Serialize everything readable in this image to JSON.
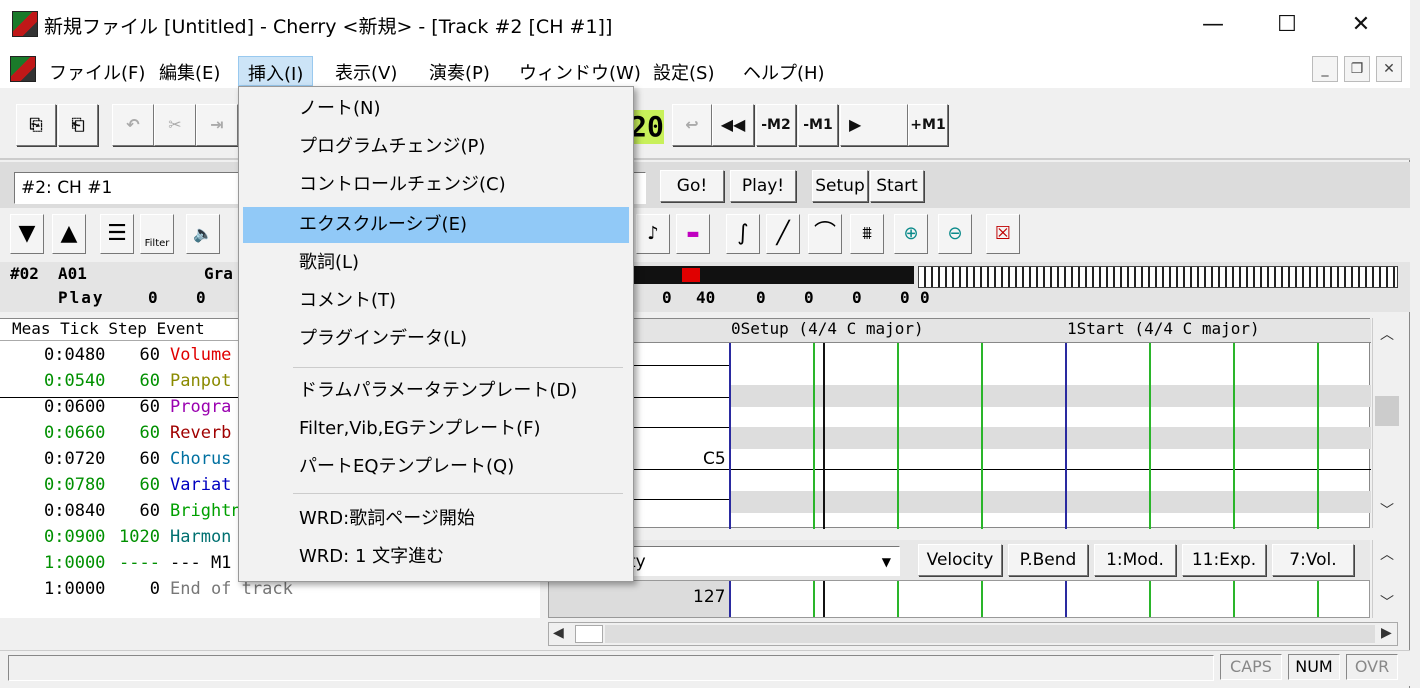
{
  "window": {
    "title": "新規ファイル [Untitled] - Cherry <新規>  - [Track #2 [CH #1]]",
    "minimize": "—",
    "maximize": "☐",
    "close": "✕"
  },
  "menubar": {
    "items": [
      "ファイル(F)",
      "編集(E)",
      "挿入(I)",
      "表示(V)",
      "演奏(P)",
      "ウィンドウ(W)",
      "設定(S)",
      "ヘルプ(H)"
    ],
    "active_index": 2
  },
  "insert_menu": {
    "items": [
      "ノート(N)",
      "プログラムチェンジ(P)",
      "コントロールチェンジ(C)",
      "エクスクルーシブ(E)",
      "歌詞(L)",
      "コメント(T)",
      "プラグインデータ(L)",
      "ドラムパラメータテンプレート(D)",
      "Filter,Vib,EGテンプレート(F)",
      "パートEQテンプレート(Q)",
      "WRD:歌詞ページ開始",
      "WRD: 1 文字進む"
    ],
    "highlighted_index": 3
  },
  "transport": {
    "counter": "20",
    "m2": "-M2",
    "m1": "-M1",
    "p1": "+M1"
  },
  "track_selector": "#2: CH #1",
  "track_buttons": {
    "go": "Go!",
    "play": "Play!",
    "setup": "Setup",
    "start": "Start"
  },
  "filter_label": "Filter",
  "status_strip": {
    "track_no": "#02",
    "port": "A01",
    "name_fragment": "Gra",
    "play_label": "Play",
    "left_vals": [
      "0",
      "0"
    ],
    "right_vals": [
      "0",
      "40",
      "0",
      "0",
      "0",
      "0"
    ],
    "kbd_val": "0"
  },
  "event_list": {
    "header": "Meas Tick Step Event",
    "rows": [
      {
        "meas": "0:0480",
        "step": "60",
        "event": "Volume",
        "color": "#e00000"
      },
      {
        "meas": "0:0540",
        "step": "60",
        "event": "Panpot",
        "color": "#8a8a00"
      },
      {
        "meas": "0:0600",
        "step": "60",
        "event": "Progra",
        "color": "#9a00b0"
      },
      {
        "meas": "0:0660",
        "step": "60",
        "event": "Reverb",
        "color": "#a00000"
      },
      {
        "meas": "0:0720",
        "step": "60",
        "event": "Chorus",
        "color": "#0070a0"
      },
      {
        "meas": "0:0780",
        "step": "60",
        "event": "Variat",
        "color": "#0000c0"
      },
      {
        "meas": "0:0840",
        "step": "60",
        "event": "Brightn",
        "color": "#00a000"
      },
      {
        "meas": "0:0900",
        "step": "1020",
        "event": "Harmon",
        "color": "#007070"
      },
      {
        "meas": "1:0000",
        "step": "----",
        "event": "--- M1",
        "color": "#000000"
      },
      {
        "meas": "1:0000",
        "step": "0",
        "event": "End of track",
        "color": "#777777"
      }
    ],
    "meas_colors": [
      "#000000",
      "#009000",
      "#000000",
      "#009000",
      "#000000",
      "#009000",
      "#000000",
      "#009000",
      "#009000",
      "#000000"
    ]
  },
  "piano_roll": {
    "marker_setup": "0Setup (4/4 C major)",
    "marker_start": "1Start (4/4 C major)",
    "note_label": "C5"
  },
  "velocity_pane": {
    "dropdown_text": "ty",
    "tabs": [
      "Velocity",
      "P.Bend",
      "1:Mod.",
      "11:Exp.",
      "7:Vol."
    ],
    "value": "127"
  },
  "statusbar": {
    "caps": "CAPS",
    "num": "NUM",
    "ovr": "OVR"
  },
  "colors": {
    "menu_highlight": "#91c9f7",
    "green_grid": "#2ab52a",
    "blue_grid": "#2a2aa0",
    "counter_bg": "#c8f05a"
  }
}
